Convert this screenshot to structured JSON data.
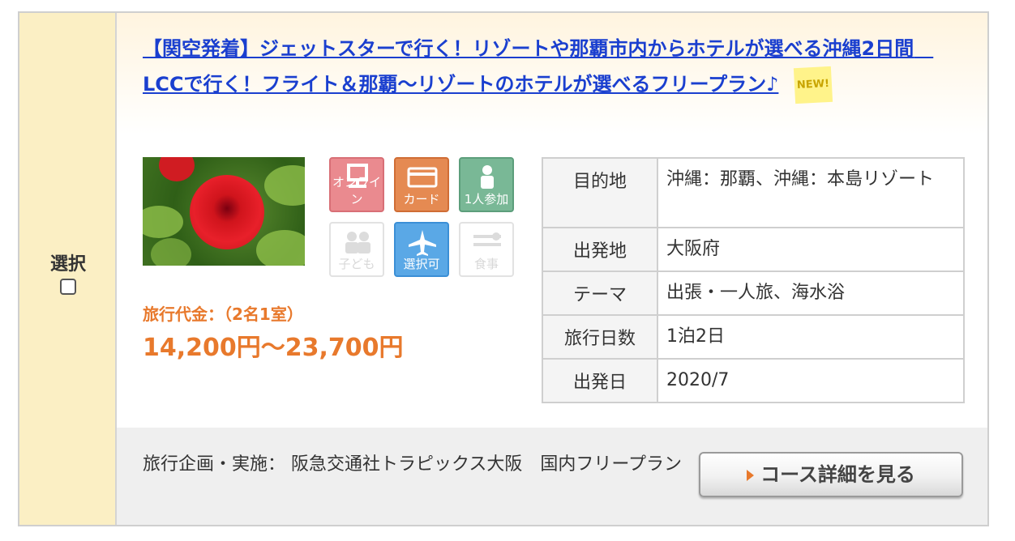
{
  "select": {
    "label": "選択"
  },
  "plan": {
    "title": "【関空発着】ジェットスターで行く！リゾートや那覇市内からホテルが選べる沖縄2日間　LCCで行く！フライト＆那覇〜リゾートのホテルが選べるフリープラン♪",
    "new_badge": "NEW!",
    "photo": "hibiscus-photo"
  },
  "icons": [
    {
      "name": "online-icon",
      "label": "オンライン",
      "active": true,
      "color": "#ea8a8f"
    },
    {
      "name": "card-icon",
      "label": "カード",
      "active": true,
      "color": "#e58a52"
    },
    {
      "name": "solo-icon",
      "label": "1人参加",
      "active": true,
      "color": "#79b896"
    },
    {
      "name": "children-icon",
      "label": "子ども",
      "active": false
    },
    {
      "name": "flight-select-icon",
      "label": "選択可",
      "active": true,
      "color": "#5aa8e6"
    },
    {
      "name": "meal-icon",
      "label": "食事",
      "active": false
    }
  ],
  "price": {
    "label": "旅行代金：（2名1室）",
    "value": "14,200円〜23,700円"
  },
  "info": [
    {
      "key": "目的地",
      "value": "沖縄：那覇、沖縄：本島リゾート"
    },
    {
      "key": "出発地",
      "value": "大阪府"
    },
    {
      "key": "テーマ",
      "value": "出張・一人旅、海水浴"
    },
    {
      "key": "旅行日数",
      "value": "1泊2日"
    },
    {
      "key": "出発日",
      "value": "2020/7"
    }
  ],
  "footer": {
    "organizer": "旅行企画・実施：  阪急交通社トラピックス大阪　国内フリープラン",
    "detail_button": "コース詳細を見る"
  },
  "colors": {
    "accent": "#e8792c",
    "link": "#1a3fcf",
    "select_bg": "#fbefc4"
  }
}
